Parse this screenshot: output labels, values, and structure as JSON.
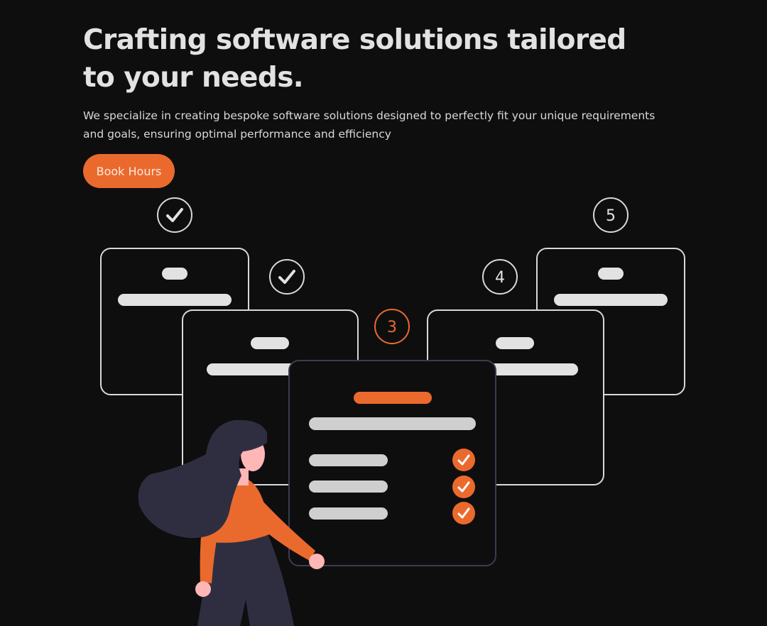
{
  "hero": {
    "title": "Crafting software solutions tailored to your needs.",
    "subtitle": "We specialize in creating bespoke software solutions designed to perfectly fit your unique requirements and goals, ensuring optimal performance and efficiency",
    "cta_label": "Book Hours"
  },
  "illustration": {
    "steps": [
      {
        "label": "",
        "state": "done"
      },
      {
        "label": "",
        "state": "done"
      },
      {
        "label": "3",
        "state": "current"
      },
      {
        "label": "4",
        "state": "upcoming"
      },
      {
        "label": "5",
        "state": "upcoming"
      }
    ],
    "checklist_items_checked": 3
  },
  "colors": {
    "background": "#0f0e0f",
    "accent": "#ea6a2e",
    "card_stroke": "#d8d8d8",
    "text_light": "#e2e2e2",
    "figure_dark": "#2f2e41",
    "skin": "#ffb6b6"
  }
}
